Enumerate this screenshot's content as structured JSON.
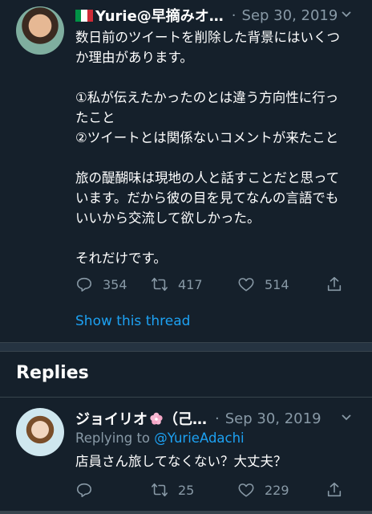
{
  "tweet": {
    "author_name": "Yurie@早摘みオ…",
    "flag_icon": "italy-flag-icon",
    "flag_colors": [
      "#009246",
      "#ffffff",
      "#ce2b37"
    ],
    "separator_dot": "·",
    "date": "Sep 30, 2019",
    "lines": [
      "数日前のツイートを削除した背景にはいくつ",
      "か理由があります。",
      "",
      "①私が伝えたかったのとは違う方向性に行っ",
      "たこと",
      "②ツイートとは関係ないコメントが来たこと",
      "",
      "旅の醍醐味は現地の人と話すことだと思って",
      "います。だから彼の目を見てなんの言語でも",
      "いいから交流して欲しかった。",
      "",
      "それだけです。"
    ],
    "reply_count": "354",
    "retweet_count": "417",
    "like_count": "514",
    "show_thread": "Show this thread"
  },
  "replies_header": "Replies",
  "reply": {
    "author_name": "ジョイリオ",
    "author_suffix": "（己…",
    "emoji_icon": "sakura-icon",
    "separator_dot": "·",
    "date": "Sep 30, 2019",
    "replying_prefix": "Replying to",
    "replying_to": "@YurieAdachi",
    "text": "店員さん旅してなくない？大丈夫？",
    "reply_count": "",
    "retweet_count": "25",
    "like_count": "229"
  },
  "colors": {
    "background": "#15202b",
    "text": "#ffffff",
    "secondary_text": "#8899a6",
    "link": "#1da1f2",
    "divider": "#38444d"
  }
}
